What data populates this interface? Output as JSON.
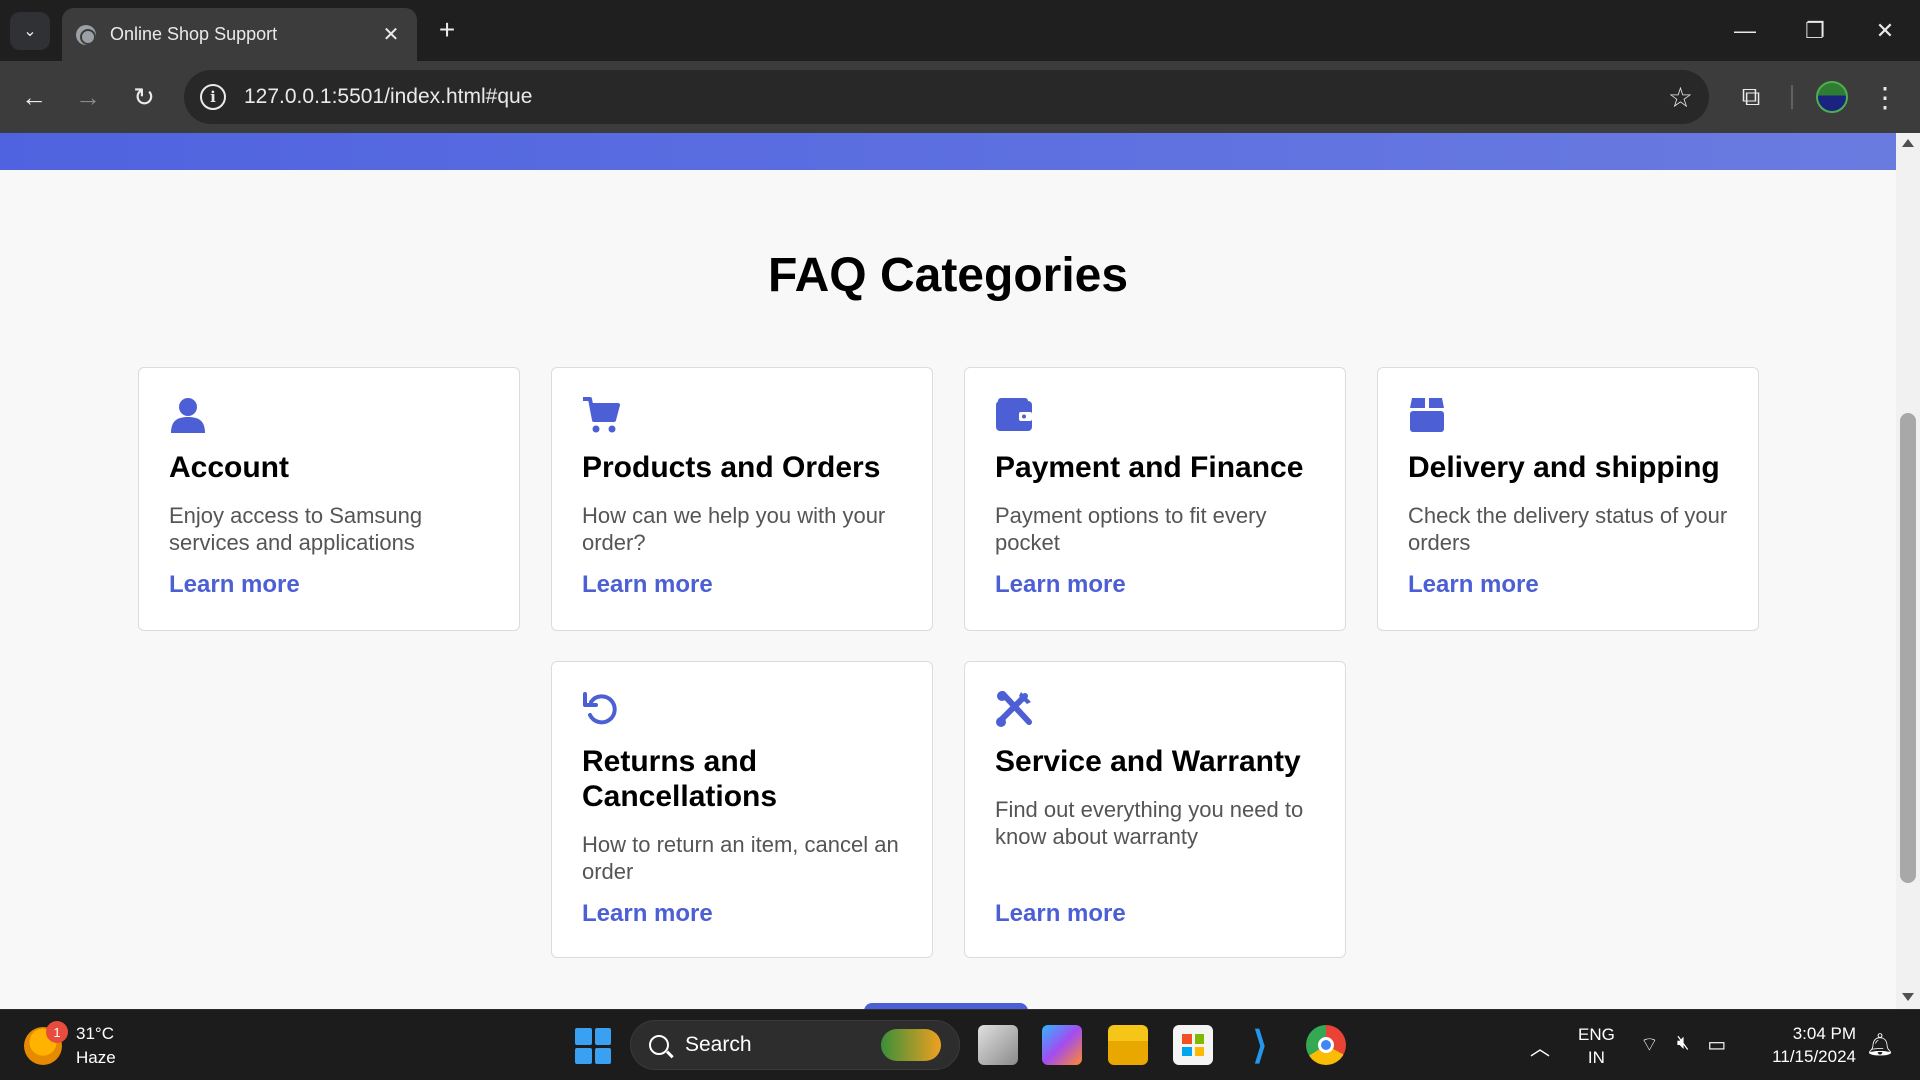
{
  "browser": {
    "tab_title": "Online Shop Support",
    "tab_close": "✕",
    "new_tab": "+",
    "url": "127.0.0.1:5501/index.html#que",
    "window": {
      "minimize": "—",
      "restore": "❐",
      "close": "✕"
    }
  },
  "page": {
    "heading": "FAQ Categories",
    "accent_color": "#4c5fd5",
    "categories": [
      {
        "icon": "user-icon",
        "title": "Account",
        "description": "Enjoy access to Samsung services and applications",
        "link": "Learn more"
      },
      {
        "icon": "cart-icon",
        "title": "Products and Orders",
        "description": "How can we help you with your order?",
        "link": "Learn more"
      },
      {
        "icon": "wallet-icon",
        "title": "Payment and Finance",
        "description": "Payment options to fit every pocket",
        "link": "Learn more"
      },
      {
        "icon": "box-icon",
        "title": "Delivery and shipping",
        "description": "Check the delivery status of your orders",
        "link": "Learn more"
      },
      {
        "icon": "undo-icon",
        "title": "Returns and Cancellations",
        "description": "How to return an item, cancel an order",
        "link": "Learn more"
      },
      {
        "icon": "tools-icon",
        "title": "Service and Warranty",
        "description": "Find out everything you need to know about warranty",
        "link": "Learn more"
      }
    ]
  },
  "taskbar": {
    "weather_temp": "31°C",
    "weather_desc": "Haze",
    "weather_badge": "1",
    "search_label": "Search",
    "lang_top": "ENG",
    "lang_bottom": "IN",
    "time": "3:04 PM",
    "date": "11/15/2024"
  }
}
